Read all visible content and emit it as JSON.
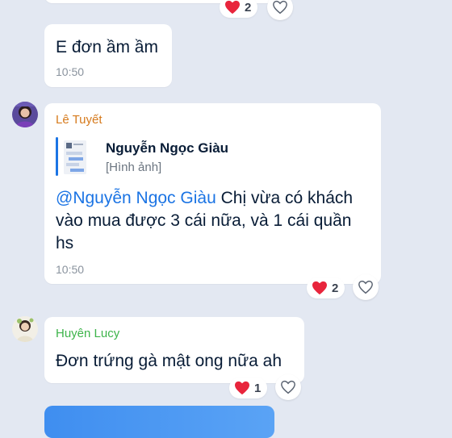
{
  "colors": {
    "background": "#e3e8f2",
    "bubble": "#ffffff",
    "mention": "#1b74e4",
    "sender_le_tuyet": "#d67a1c",
    "sender_huyen_lucy": "#3db44a",
    "heart": "#e8253c"
  },
  "messages": [
    {
      "reaction": {
        "icon": "red-heart-icon",
        "count": "2"
      }
    },
    {
      "text": "E đơn ầm ầm",
      "time": "10:50"
    },
    {
      "sender": "Lê Tuyết",
      "quote": {
        "author": "Nguyễn Ngọc Giàu",
        "preview": "[Hình ảnh]"
      },
      "mention": "@Nguyễn Ngọc Giàu",
      "text_line1": " Chị vừa có khách",
      "text_line2": "vào mua được 3 cái nữa, và 1 cái quần",
      "text_line3": "hs",
      "time": "10:50",
      "reaction": {
        "icon": "red-heart-icon",
        "count": "2"
      }
    },
    {
      "sender": "Huyên Lucy",
      "text": "Đơn trứng gà mật ong nữa ah",
      "reaction": {
        "icon": "red-heart-icon",
        "count": "1"
      }
    }
  ]
}
